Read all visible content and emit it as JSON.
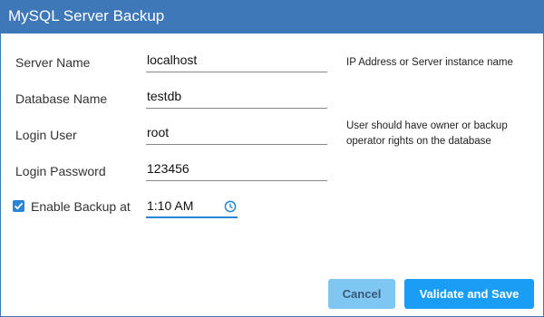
{
  "window": {
    "title": "MySQL Server Backup"
  },
  "form": {
    "server_name": {
      "label": "Server Name",
      "value": "localhost",
      "hint": "IP Address or Server instance name"
    },
    "database_name": {
      "label": "Database Name",
      "value": "testdb"
    },
    "login_user": {
      "label": "Login User",
      "value": "root",
      "hint": "User should have owner or backup operator rights on the database"
    },
    "login_password": {
      "label": "Login Password",
      "value": "123456"
    },
    "backup": {
      "label": "Enable Backup at",
      "checked": true,
      "time": "1:10 AM",
      "time_icon": "clock-icon"
    }
  },
  "buttons": {
    "cancel_label": "Cancel",
    "save_label": "Validate and Save"
  },
  "colors": {
    "titlebar": "#3f78b8",
    "accent": "#2b85d6",
    "cancel_bg": "#7fc7f3",
    "save_bg": "#1a9ef5"
  }
}
